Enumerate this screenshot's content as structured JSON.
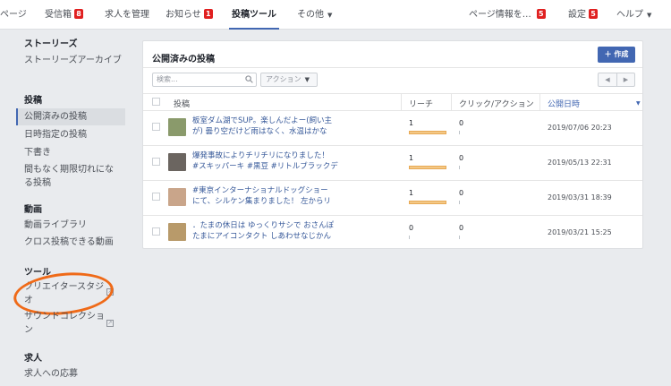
{
  "nav": {
    "tabs": [
      {
        "label": "ページ"
      },
      {
        "label": "受信箱",
        "badge": "8"
      },
      {
        "label": "求人を管理"
      },
      {
        "label": "お知らせ",
        "badge": "1"
      },
      {
        "label": "投稿ツール"
      },
      {
        "label": "その他"
      },
      {
        "label": "ページ情報を…",
        "badge": "5"
      },
      {
        "label": "設定",
        "badge": "5"
      },
      {
        "label": "ヘルプ"
      }
    ]
  },
  "sidebar": {
    "stories_heading": "ストーリーズ",
    "stories_archive": "ストーリーズアーカイブ",
    "posts_heading": "投稿",
    "published": "公開済みの投稿",
    "scheduled": "日時指定の投稿",
    "drafts": "下書き",
    "expiring_1": "間もなく期限切れにな",
    "expiring_2": "る投稿",
    "video_heading": "動画",
    "video_library": "動画ライブラリ",
    "crosspost": "クロス投稿できる動画",
    "tools_heading": "ツール",
    "creator_studio_1": "クリエイタースタジ",
    "creator_studio_2": "オ",
    "sound_collection_1": "サウンドコレクショ",
    "sound_collection_2": "ン",
    "jobs_heading": "求人",
    "job_applications": "求人への応募"
  },
  "panel": {
    "title": "公開済みの投稿",
    "create_label": "作成",
    "search_placeholder": "検索...",
    "action_label": "アクション",
    "columns": {
      "post": "投稿",
      "reach": "リーチ",
      "clicks": "クリック/アクション",
      "date": "公開日時"
    },
    "rows": [
      {
        "line1": "板室ダム湖でSUP。楽しんだよー(飼い主",
        "line2": "が) 曇り空だけど雨はなく、水温はかな",
        "reach": "1",
        "reach_fraction": 1,
        "clicks": "0",
        "date": "2019/07/06 20:23",
        "thumb_color": "#8a9a6b"
      },
      {
        "line1": "爆発事故によりチリチリになりました！",
        "line2": "#スキッパーキ #黒豆 #リトルブラックデ",
        "reach": "1",
        "reach_fraction": 1,
        "clicks": "0",
        "date": "2019/05/13 22:31",
        "thumb_color": "#6b6560"
      },
      {
        "line1": "#東京インターナショナルドッグショー",
        "line2": "にて、シルケン集まりました！ 左からリ",
        "reach": "1",
        "reach_fraction": 1,
        "clicks": "0",
        "date": "2019/03/31 18:39",
        "thumb_color": "#c9a58a"
      },
      {
        "line1": "．たまの休日は ゆっくりサシで おさんぽ",
        "line2": "たまにアイコンタクト しあわせなじかん",
        "reach": "0",
        "reach_fraction": 0,
        "clicks": "0",
        "date": "2019/03/21 15:25",
        "thumb_color": "#b89a6a"
      }
    ]
  }
}
